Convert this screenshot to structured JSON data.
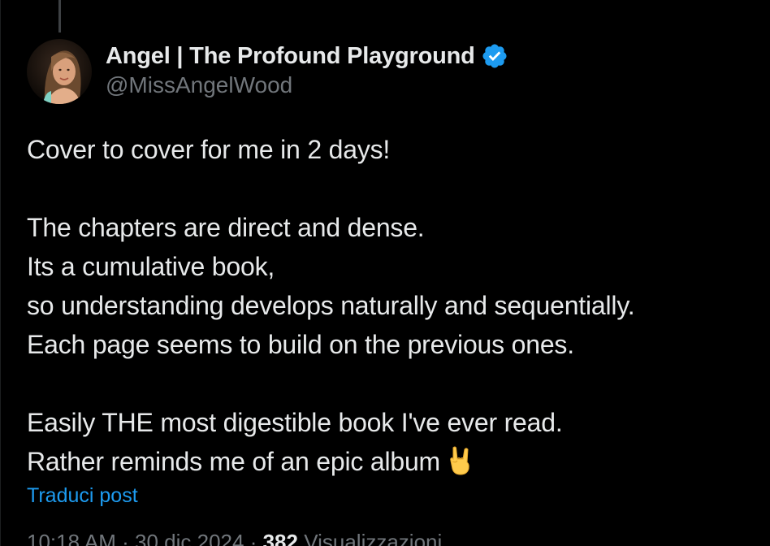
{
  "author": {
    "display_name": "Angel | The Profound Playground",
    "handle": "@MissAngelWood",
    "verified": true,
    "verified_color": "#1d9bf0"
  },
  "post": {
    "lines": [
      "Cover to cover for me in 2 days!",
      "",
      "The chapters are direct and dense.",
      "Its a cumulative book,",
      "so understanding develops naturally and sequentially.",
      "Each page seems to build on the previous ones.",
      "",
      "Easily THE most digestible book I've ever read.",
      "Rather reminds me of an epic album"
    ],
    "emoji": "sign-of-the-horns-emoji"
  },
  "translate_label": "Traduci post",
  "meta": {
    "time": "10:18 AM",
    "separator": "·",
    "date": "30 dic 2024",
    "views_count": "382",
    "views_label": "Visualizzazioni"
  },
  "colors": {
    "background": "#000000",
    "text": "#e7e9ea",
    "muted": "#71767b",
    "link": "#1d9bf0"
  }
}
